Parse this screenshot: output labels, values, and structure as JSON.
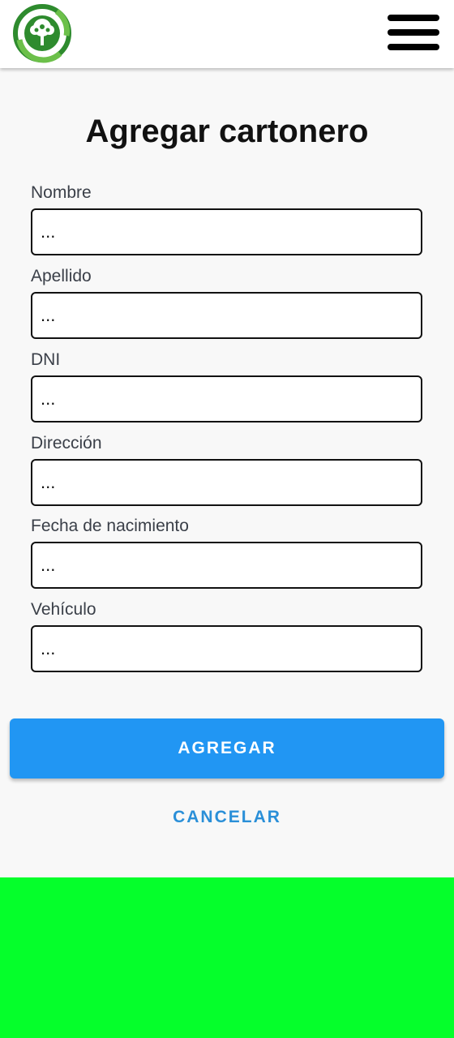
{
  "header": {
    "logo_icon": "recycling-tree-logo",
    "menu_icon": "hamburger-menu-icon"
  },
  "form": {
    "title": "Agregar cartonero",
    "fields": [
      {
        "label": "Nombre",
        "value": "",
        "placeholder": "..."
      },
      {
        "label": "Apellido",
        "value": "",
        "placeholder": "..."
      },
      {
        "label": "DNI",
        "value": "",
        "placeholder": "..."
      },
      {
        "label": "Dirección",
        "value": "",
        "placeholder": "..."
      },
      {
        "label": "Fecha de nacimiento",
        "value": "",
        "placeholder": "..."
      },
      {
        "label": "Vehículo",
        "value": "",
        "placeholder": "..."
      }
    ],
    "submit_label": "AGREGAR",
    "cancel_label": "CANCELAR"
  },
  "colors": {
    "primary": "#2196f3",
    "cancel_text": "#2a8fd8",
    "footer": "#05ff2b",
    "logo_green_dark": "#2e8b2e",
    "logo_green_light": "#6cc04a"
  }
}
